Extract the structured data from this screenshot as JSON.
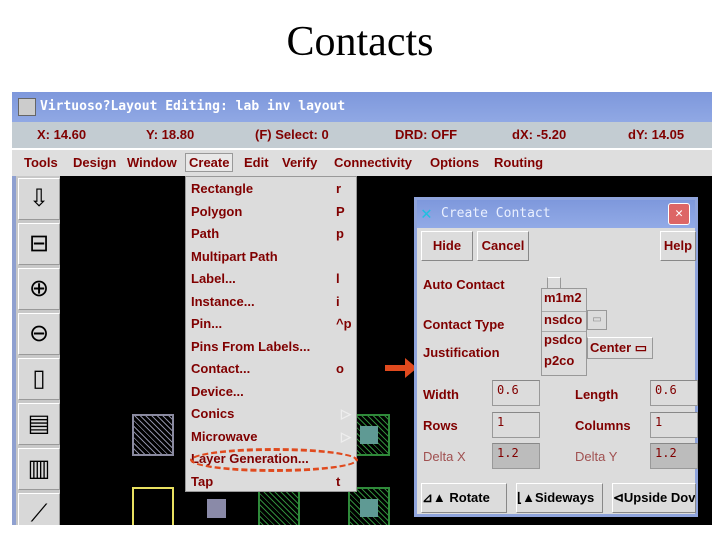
{
  "slide_title": "Contacts",
  "window": {
    "title": "Virtuoso?Layout Editing: lab inv layout"
  },
  "status": {
    "x": "X: 14.60",
    "y": "Y: 18.80",
    "select": "(F) Select: 0",
    "drd": "DRD: OFF",
    "dx": "dX: -5.20",
    "dy": "dY: 14.05"
  },
  "menubar": [
    "Tools",
    "Design",
    "Window",
    "Create",
    "Edit",
    "Verify",
    "Connectivity",
    "Options",
    "Routing"
  ],
  "create_menu": [
    {
      "label": "Rectangle",
      "accel": "r"
    },
    {
      "label": "Polygon",
      "accel": "P"
    },
    {
      "label": "Path",
      "accel": "p"
    },
    {
      "label": "Multipart Path",
      "accel": ""
    },
    {
      "label": "Label...",
      "accel": "l"
    },
    {
      "label": "Instance...",
      "accel": "i"
    },
    {
      "label": "Pin...",
      "accel": "^p"
    },
    {
      "label": "Pins From Labels...",
      "accel": ""
    },
    {
      "label": "Contact...",
      "accel": "o"
    },
    {
      "label": "Device...",
      "accel": ""
    },
    {
      "label": "Conics",
      "accel": "▷"
    },
    {
      "label": "Microwave",
      "accel": "▷"
    },
    {
      "label": "Layer Generation...",
      "accel": ""
    },
    {
      "label": "Tap",
      "accel": "t"
    }
  ],
  "toolbar_icons": [
    "save-icon",
    "fit-icon",
    "zoom-in-icon",
    "zoom-out-icon",
    "select-area-icon",
    "select-rows-icon",
    "select-partial-icon",
    "ruler-icon"
  ],
  "dialog": {
    "title": "Create Contact",
    "hide": "Hide",
    "cancel": "Cancel",
    "help": "Help",
    "auto_contact": "Auto Contact",
    "contact_type": "Contact Type",
    "justification": "Justification",
    "contact_options": [
      "m1m2",
      "nsdco",
      "psdco",
      "p2co"
    ],
    "justification_value": "Center",
    "width_label": "Width",
    "width": "0.6",
    "length_label": "Length",
    "length": "0.6",
    "rows_label": "Rows",
    "rows": "1",
    "columns_label": "Columns",
    "columns": "1",
    "delta_x_label": "Delta X",
    "delta_x": "1.2",
    "delta_y_label": "Delta Y",
    "delta_y": "1.2",
    "rotate": "Rotate",
    "sideways": "Sideways",
    "upside_down": "Upside Dov"
  },
  "colors": {
    "text": "#800000",
    "highlight": "#e04a1e",
    "titlebar": "#7e98dc"
  }
}
